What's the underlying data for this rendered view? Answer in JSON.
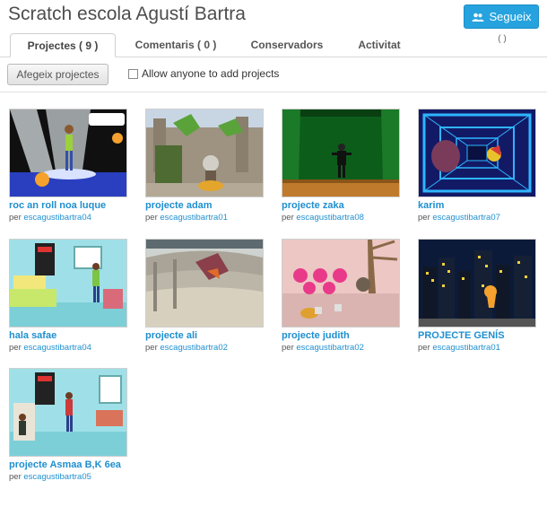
{
  "studio": {
    "title": "Scratch escola Agustí Bartra",
    "follow_label": "Segueix"
  },
  "tabs": [
    {
      "label": "Projectes ( 9 )",
      "active": true
    },
    {
      "label": "Comentaris ( 0 )",
      "active": false
    },
    {
      "label": "Conservadors",
      "active": false
    },
    {
      "label": "Activitat",
      "active": false
    }
  ],
  "extra_count": "( )",
  "toolbar": {
    "add_label": "Afegeix projectes",
    "allow_label": "Allow anyone to add projects",
    "allow_checked": false
  },
  "projects": [
    {
      "title": "roc an roll noa luque",
      "by": "per",
      "owner": "escagustibartra04"
    },
    {
      "title": "projecte adam",
      "by": "per",
      "owner": "escagustibartra01"
    },
    {
      "title": "projecte zaka",
      "by": "per",
      "owner": "escagustibartra08"
    },
    {
      "title": "karim",
      "by": "per",
      "owner": "escagustibartra07"
    },
    {
      "title": "hala safae",
      "by": "per",
      "owner": "escagustibartra04"
    },
    {
      "title": "projecte ali",
      "by": "per",
      "owner": "escagustibartra02"
    },
    {
      "title": "projecte judith",
      "by": "per",
      "owner": "escagustibartra02"
    },
    {
      "title": "PROJECTE GENÍS",
      "by": "per",
      "owner": "escagustibartra01"
    },
    {
      "title": "projecte Asmaa B,K 6ea",
      "by": "per",
      "owner": "escagustibartra05"
    }
  ],
  "colors": {
    "accent": "#26a3de",
    "link": "#1f8fcf"
  }
}
